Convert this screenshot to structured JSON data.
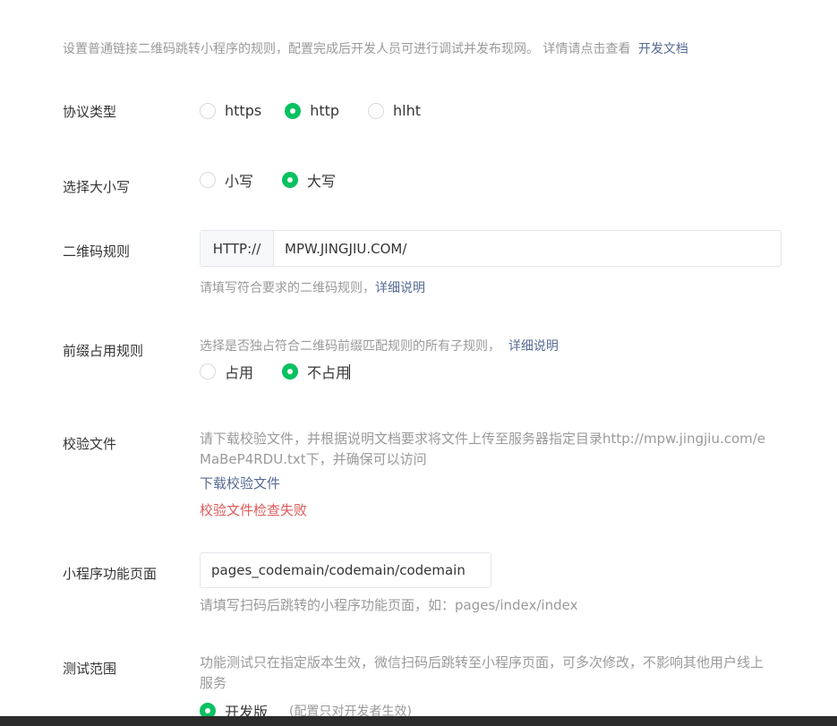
{
  "intro": {
    "text": "设置普通链接二维码跳转小程序的规则，配置完成后开发人员可进行调试并发布现网。 详情请点击查看",
    "link": "开发文档"
  },
  "protocol": {
    "label": "协议类型",
    "options": [
      "https",
      "http",
      "hlht"
    ],
    "selected": "http"
  },
  "case": {
    "label": "选择大小写",
    "options": [
      "小写",
      "大写"
    ],
    "selected": "大写"
  },
  "qr_rule": {
    "label": "二维码规则",
    "prefix": "HTTP://",
    "value": "MPW.JINGJIU.COM/",
    "hint": "请填写符合要求的二维码规则，",
    "hint_link": "详细说明"
  },
  "prefix_rule": {
    "label": "前缀占用规则",
    "hint": "选择是否独占符合二维码前缀匹配规则的所有子规则，",
    "hint_link": "详细说明",
    "options": [
      "占用",
      "不占用"
    ],
    "selected": "不占用"
  },
  "verify_file": {
    "label": "校验文件",
    "desc": "请下载校验文件，并根据说明文档要求将文件上传至服务器指定目录http://mpw.jingjiu.com/eMaBeP4RDU.txt下，并确保可以访问",
    "download_link": "下载校验文件",
    "error": "校验文件检查失败"
  },
  "mini_page": {
    "label": "小程序功能页面",
    "value": "pages_codemain/codemain/codemain",
    "hint": "请填写扫码后跳转的小程序功能页面，如：pages/index/index"
  },
  "test_range": {
    "label": "测试范围",
    "desc": "功能测试只在指定版本生效，微信扫码后跳转至小程序页面，可多次修改，不影响其他用户线上服务",
    "option": "开发版",
    "option_note": "(配置只对开发者生效)"
  },
  "colors": {
    "accent": "#07c160",
    "link": "#576b95",
    "error": "#e05a5a"
  }
}
